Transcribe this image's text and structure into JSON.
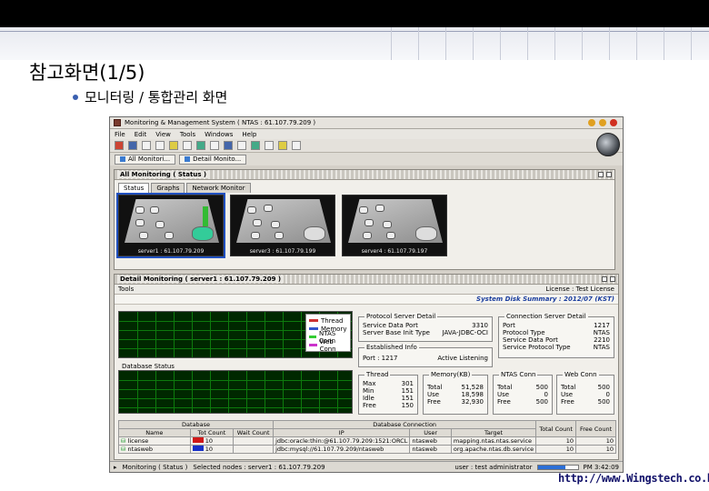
{
  "slide": {
    "title": "참고화면(1/5)",
    "bullet": "모니터링 / 통합관리 화면",
    "url": "http://www.Wingstech.co.kr"
  },
  "window": {
    "title": "Monitoring & Management System ( NTAS : 61.107.79.209 )",
    "menu": [
      "File",
      "Edit",
      "View",
      "Tools",
      "Windows",
      "Help"
    ],
    "doc_tabs": [
      "All Monitori...",
      "Detail Monito..."
    ]
  },
  "all_monitoring": {
    "title": "All Monitoring ( Status )",
    "tabs": [
      "Status",
      "Graphs",
      "Network Monitor"
    ],
    "servers": [
      "server1 : 61.107.79.209",
      "server3 : 61.107.79.199",
      "server4 : 61.107.79.197"
    ]
  },
  "detail": {
    "title": "Detail Monitoring ( server1 : 61.107.79.209 )",
    "tools_label": "Tools",
    "license_label": "License : Test License",
    "info_right": "System Disk Summary : 2012/07 (KST)",
    "legend": [
      "Thread",
      "Memory",
      "NTAS Conn",
      "Web Conn"
    ],
    "legend_colors": [
      "#cc3333",
      "#3355cc",
      "#33cc33",
      "#cc33cc"
    ],
    "graph2_title": "Database Status",
    "protocol_box": {
      "title": "Protocol Server Detail",
      "rows": [
        [
          "Service Data Port",
          "3310"
        ],
        [
          "Server Base Init Type",
          "JAVA-JDBC-OCI"
        ]
      ]
    },
    "listen_box": {
      "title": "Established Info",
      "port_label": "Port : 1217",
      "status_label": "Active Listening"
    },
    "conn_box": {
      "title": "Connection Server Detail",
      "rows": [
        [
          "Port",
          "1217"
        ],
        [
          "Protocol Type",
          "NTAS"
        ],
        [
          "Service Data Port",
          "2210"
        ],
        [
          "Service Protocol Type",
          "NTAS"
        ]
      ]
    },
    "thread": {
      "title": "Thread",
      "rows": [
        [
          "Max",
          "301"
        ],
        [
          "Min",
          "151"
        ],
        [
          "Idle",
          "151"
        ],
        [
          "Free",
          "150"
        ]
      ]
    },
    "memory": {
      "title": "Memory(KB)",
      "rows": [
        [
          "Total",
          "51,528"
        ],
        [
          "Use",
          "18,598"
        ],
        [
          "Free",
          "32,930"
        ]
      ]
    },
    "ntas_conn": {
      "title": "NTAS Conn",
      "rows": [
        [
          "Total",
          "500"
        ],
        [
          "Use",
          "0"
        ],
        [
          "Free",
          "500"
        ]
      ]
    },
    "web_conn": {
      "title": "Web Conn",
      "rows": [
        [
          "Total",
          "500"
        ],
        [
          "Use",
          "0"
        ],
        [
          "Free",
          "500"
        ]
      ]
    },
    "db_table": {
      "group_left": "Database",
      "group_right": "Database Connection",
      "headers": [
        "Name",
        "Tot Count",
        "Wait Count",
        "IP",
        "User",
        "Target",
        "Total Count",
        "Free Count"
      ],
      "rows": [
        [
          "license",
          "#d01818",
          "10",
          "",
          "jdbc:oracle:thin:@61.107.79.209:1521:ORCL",
          "ntasweb",
          "mapping.ntas.ntas.service",
          "10",
          "10"
        ],
        [
          "ntasweb",
          "#1830c8",
          "10",
          "",
          "jdbc:mysql://61.107.79.209/ntasweb",
          "ntasweb",
          "org.apache.ntas.db.service",
          "10",
          "10"
        ]
      ]
    }
  },
  "statusbar": {
    "left": "Monitoring ( Status )",
    "selected": "Selected nodes : server1 : 61.107.79.209",
    "right": "user : test administrator",
    "clock": "PM 3:42:09",
    "progress": 0.7
  }
}
